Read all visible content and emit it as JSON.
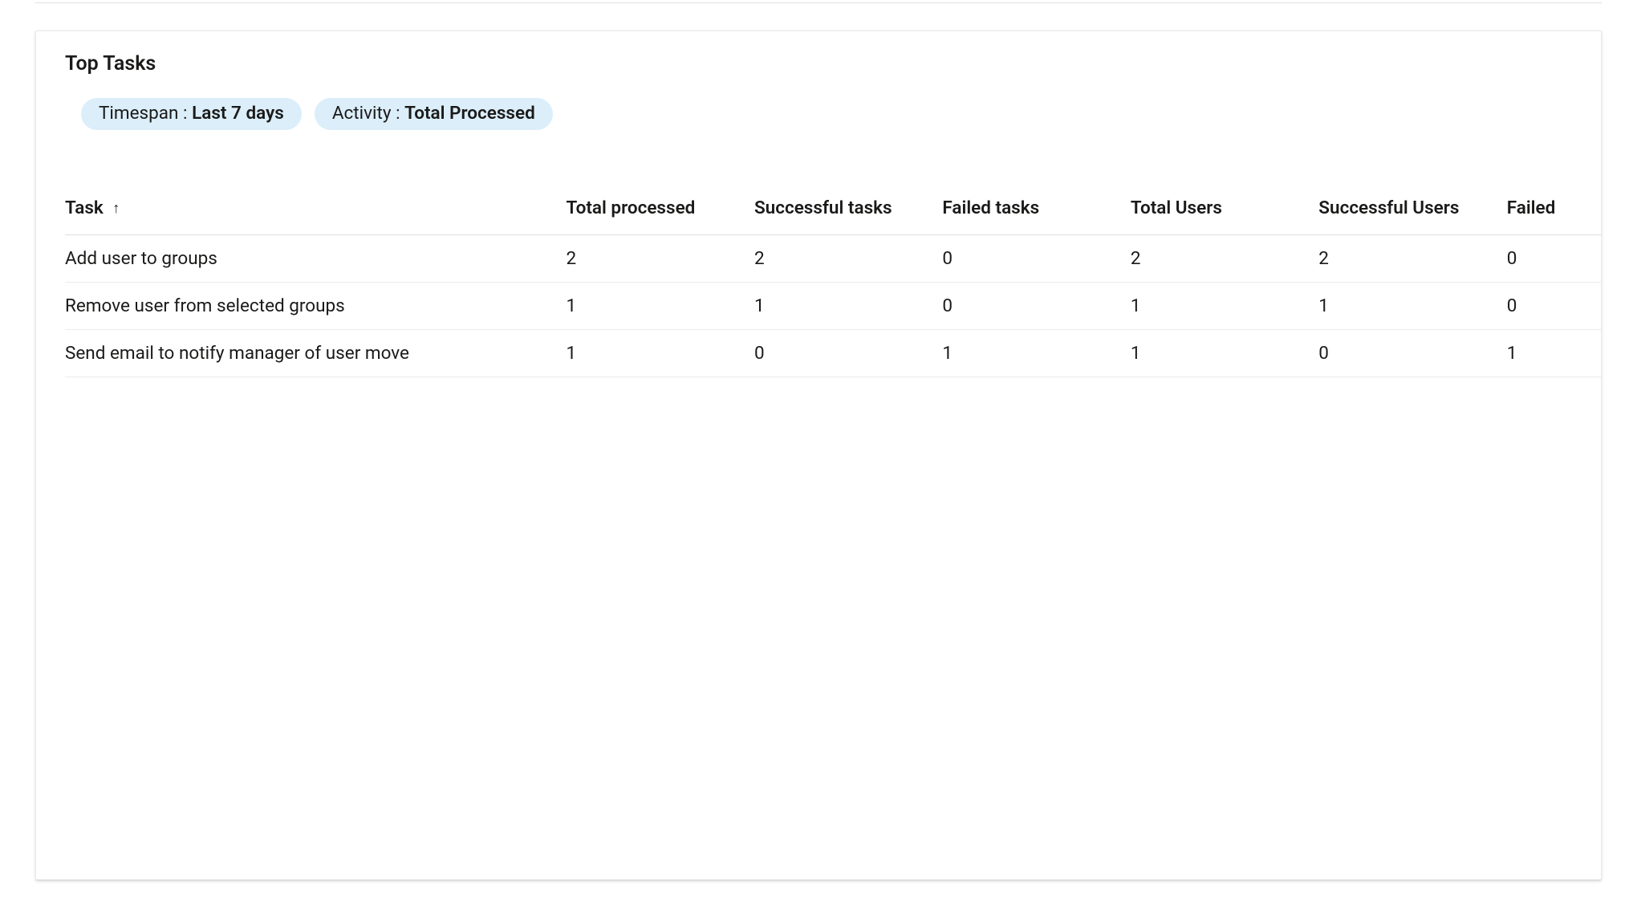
{
  "card": {
    "title": "Top Tasks"
  },
  "filters": {
    "timespan_label": "Timespan : ",
    "timespan_value": "Last 7 days",
    "activity_label": "Activity : ",
    "activity_value": "Total Processed"
  },
  "table": {
    "headers": {
      "task": "Task",
      "total_processed": "Total processed",
      "successful_tasks": "Successful tasks",
      "failed_tasks": "Failed tasks",
      "total_users": "Total Users",
      "successful_users": "Successful Users",
      "failed": "Failed"
    },
    "sort_icon": "↑",
    "rows": [
      {
        "task": "Add user to groups",
        "total_processed": "2",
        "successful_tasks": "2",
        "failed_tasks": "0",
        "total_users": "2",
        "successful_users": "2",
        "failed": "0"
      },
      {
        "task": "Remove user from selected groups",
        "total_processed": "1",
        "successful_tasks": "1",
        "failed_tasks": "0",
        "total_users": "1",
        "successful_users": "1",
        "failed": "0"
      },
      {
        "task": "Send email to notify manager of user move",
        "total_processed": "1",
        "successful_tasks": "0",
        "failed_tasks": "1",
        "total_users": "1",
        "successful_users": "0",
        "failed": "1"
      }
    ]
  }
}
